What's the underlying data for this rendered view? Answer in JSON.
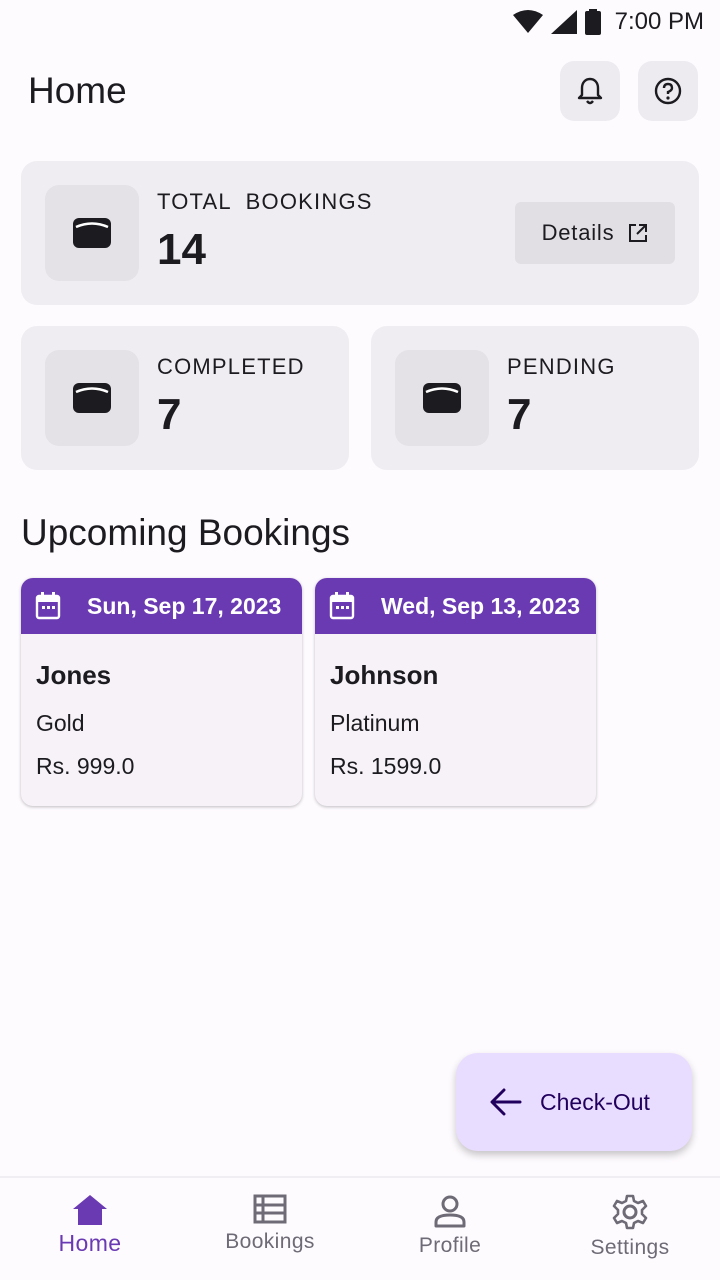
{
  "status_bar": {
    "time": "7:00 PM"
  },
  "app_bar": {
    "title": "Home"
  },
  "stats": {
    "total": {
      "label": "TOTAL  BOOKINGS",
      "value": "14",
      "details_label": "Details"
    },
    "completed": {
      "label": "COMPLETED",
      "value": "7"
    },
    "pending": {
      "label": "PENDING",
      "value": "7"
    }
  },
  "upcoming": {
    "title": "Upcoming Bookings",
    "bookings": [
      {
        "date": "Sun, Sep 17, 2023",
        "name": "Jones",
        "plan": "Gold",
        "price": "Rs. 999.0"
      },
      {
        "date": "Wed, Sep 13, 2023",
        "name": "Johnson",
        "plan": "Platinum",
        "price": "Rs. 1599.0"
      }
    ]
  },
  "fab": {
    "label": "Check-Out"
  },
  "bottom_nav": {
    "items": [
      {
        "label": "Home",
        "icon": "home-icon",
        "active": true
      },
      {
        "label": "Bookings",
        "icon": "list-icon",
        "active": false
      },
      {
        "label": "Profile",
        "icon": "person-icon",
        "active": false
      },
      {
        "label": "Settings",
        "icon": "gear-icon",
        "active": false
      }
    ]
  },
  "colors": {
    "primary": "#6a3ab2",
    "fab_bg": "#e9ddff",
    "card_bg": "#efedf1",
    "background": "#fefbff"
  }
}
